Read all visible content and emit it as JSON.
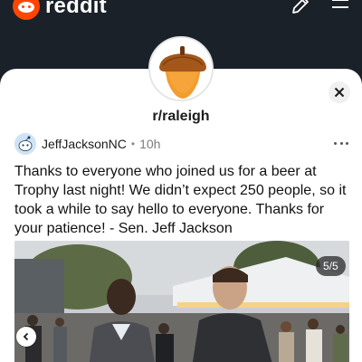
{
  "header": {
    "brand_name": "reddit",
    "icons": [
      "reddit-logo-icon",
      "edit-icon",
      "menu-icon"
    ]
  },
  "community": {
    "name": "r/raleigh",
    "avatar_icon": "acorn-icon",
    "close_icon": "close-icon"
  },
  "post": {
    "author": "JeffJacksonNC",
    "separator": "•",
    "age": "10h",
    "title": "Thanks to everyone who joined us for a beer at Trophy last night! We didn’t expect 250 people, so it took a while to say hello to everyone. Thanks for your patience! - Sen. Jeff Jackson",
    "more_icon": "more-options-icon"
  },
  "gallery": {
    "counter": "5/5",
    "prev_icon": "chevron-left-icon"
  },
  "colors": {
    "topbar_bg": "#1a2129",
    "brand_orange": "#ff4500",
    "acorn_cap": "#b5651d",
    "acorn_body": "#f39c2f",
    "sheet_bg": "#ffffff"
  }
}
